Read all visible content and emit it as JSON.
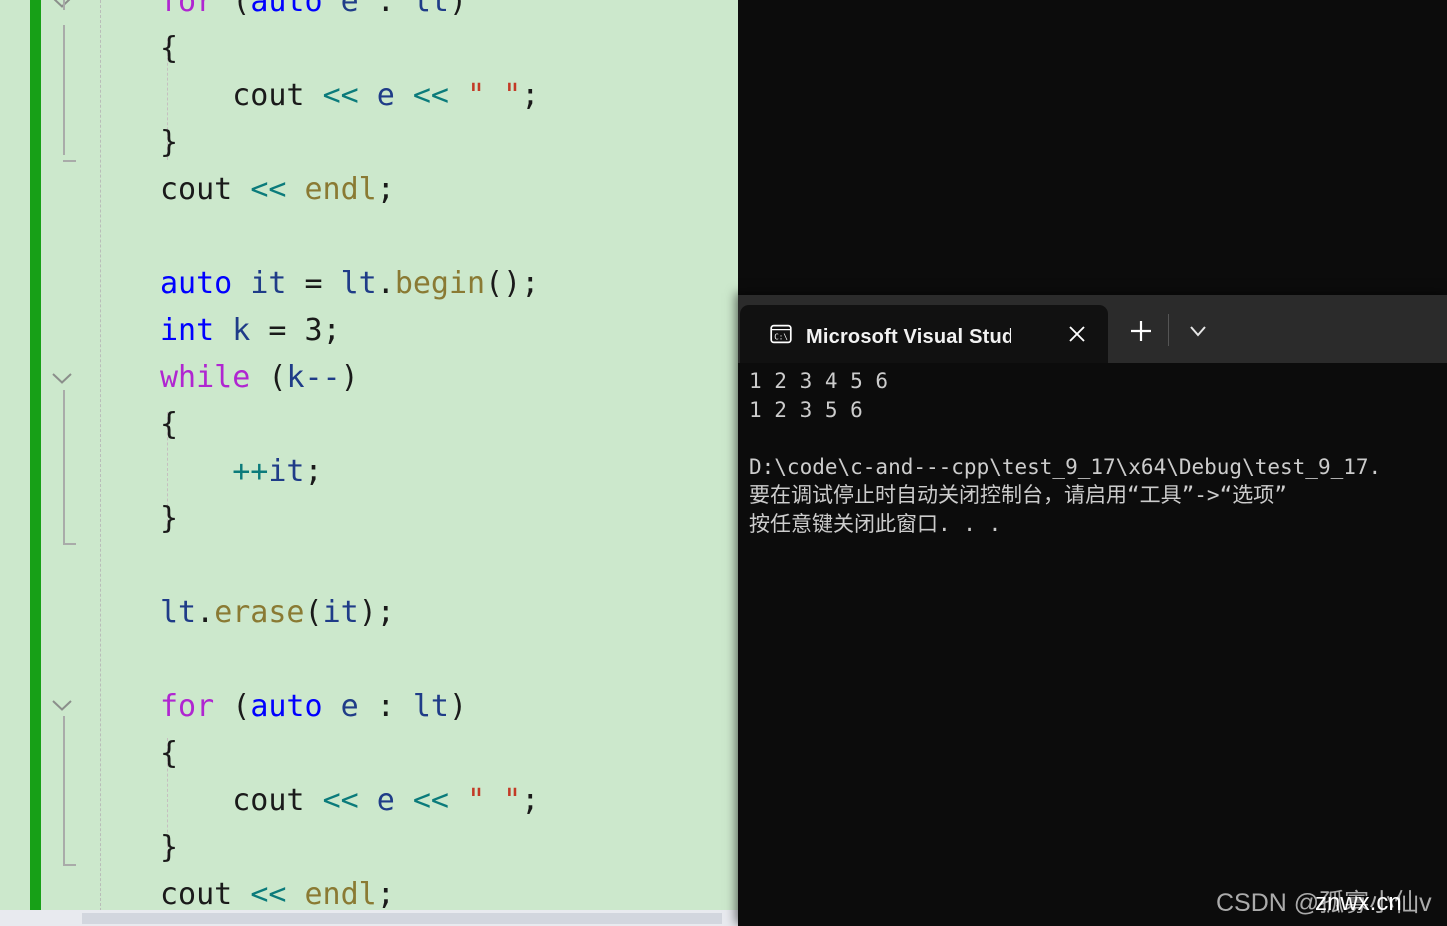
{
  "editor": {
    "name": "visual-studio-code-editor",
    "background_color": "#cce8cc",
    "change_bar_color": "#17a017",
    "lines": [
      {
        "indent": 0,
        "tokens": [
          {
            "t": "for",
            "c": "kwctl"
          },
          {
            "t": " ",
            "c": "plain"
          },
          {
            "t": "(",
            "c": "punct"
          },
          {
            "t": "auto",
            "c": "kw"
          },
          {
            "t": " ",
            "c": "plain"
          },
          {
            "t": "e",
            "c": "var"
          },
          {
            "t": " : ",
            "c": "punct"
          },
          {
            "t": "lt",
            "c": "var"
          },
          {
            "t": ")",
            "c": "punct"
          }
        ]
      },
      {
        "indent": 0,
        "tokens": [
          {
            "t": "{",
            "c": "punct"
          }
        ]
      },
      {
        "indent": 0,
        "tokens": [
          {
            "t": "    ",
            "c": "plain"
          },
          {
            "t": "cout",
            "c": "ident"
          },
          {
            "t": " ",
            "c": "plain"
          },
          {
            "t": "<<",
            "c": "op"
          },
          {
            "t": " ",
            "c": "plain"
          },
          {
            "t": "e",
            "c": "var"
          },
          {
            "t": " ",
            "c": "plain"
          },
          {
            "t": "<<",
            "c": "op"
          },
          {
            "t": " ",
            "c": "plain"
          },
          {
            "t": "\" \"",
            "c": "str"
          },
          {
            "t": ";",
            "c": "punct"
          }
        ]
      },
      {
        "indent": 0,
        "tokens": [
          {
            "t": "}",
            "c": "punct"
          }
        ]
      },
      {
        "indent": 0,
        "tokens": [
          {
            "t": "cout",
            "c": "ident"
          },
          {
            "t": " ",
            "c": "plain"
          },
          {
            "t": "<<",
            "c": "op"
          },
          {
            "t": " ",
            "c": "plain"
          },
          {
            "t": "endl",
            "c": "member"
          },
          {
            "t": ";",
            "c": "punct"
          }
        ]
      },
      {
        "indent": 0,
        "tokens": []
      },
      {
        "indent": 0,
        "tokens": [
          {
            "t": "auto",
            "c": "kw"
          },
          {
            "t": " ",
            "c": "plain"
          },
          {
            "t": "it",
            "c": "var"
          },
          {
            "t": " = ",
            "c": "punct"
          },
          {
            "t": "lt",
            "c": "var"
          },
          {
            "t": ".",
            "c": "punct"
          },
          {
            "t": "begin",
            "c": "member"
          },
          {
            "t": "();",
            "c": "punct"
          }
        ]
      },
      {
        "indent": 0,
        "tokens": [
          {
            "t": "int",
            "c": "kw"
          },
          {
            "t": " ",
            "c": "plain"
          },
          {
            "t": "k",
            "c": "var"
          },
          {
            "t": " = ",
            "c": "punct"
          },
          {
            "t": "3",
            "c": "plain"
          },
          {
            "t": ";",
            "c": "punct"
          }
        ]
      },
      {
        "indent": 0,
        "tokens": [
          {
            "t": "while",
            "c": "kwctl"
          },
          {
            "t": " ",
            "c": "plain"
          },
          {
            "t": "(",
            "c": "punct"
          },
          {
            "t": "k",
            "c": "var"
          },
          {
            "t": "--",
            "c": "var"
          },
          {
            "t": ")",
            "c": "punct"
          }
        ]
      },
      {
        "indent": 0,
        "tokens": [
          {
            "t": "{",
            "c": "punct"
          }
        ]
      },
      {
        "indent": 0,
        "tokens": [
          {
            "t": "    ",
            "c": "plain"
          },
          {
            "t": "++",
            "c": "op"
          },
          {
            "t": "it",
            "c": "var"
          },
          {
            "t": ";",
            "c": "punct"
          }
        ]
      },
      {
        "indent": 0,
        "tokens": [
          {
            "t": "}",
            "c": "punct"
          }
        ]
      },
      {
        "indent": 0,
        "tokens": []
      },
      {
        "indent": 0,
        "tokens": [
          {
            "t": "lt",
            "c": "var"
          },
          {
            "t": ".",
            "c": "punct"
          },
          {
            "t": "erase",
            "c": "member"
          },
          {
            "t": "(",
            "c": "punct"
          },
          {
            "t": "it",
            "c": "var"
          },
          {
            "t": ");",
            "c": "punct"
          }
        ]
      },
      {
        "indent": 0,
        "tokens": []
      },
      {
        "indent": 0,
        "tokens": [
          {
            "t": "for",
            "c": "kwctl"
          },
          {
            "t": " ",
            "c": "plain"
          },
          {
            "t": "(",
            "c": "punct"
          },
          {
            "t": "auto",
            "c": "kw"
          },
          {
            "t": " ",
            "c": "plain"
          },
          {
            "t": "e",
            "c": "var"
          },
          {
            "t": " : ",
            "c": "punct"
          },
          {
            "t": "lt",
            "c": "var"
          },
          {
            "t": ")",
            "c": "punct"
          }
        ]
      },
      {
        "indent": 0,
        "tokens": [
          {
            "t": "{",
            "c": "punct"
          }
        ]
      },
      {
        "indent": 0,
        "tokens": [
          {
            "t": "    ",
            "c": "plain"
          },
          {
            "t": "cout",
            "c": "ident"
          },
          {
            "t": " ",
            "c": "plain"
          },
          {
            "t": "<<",
            "c": "op"
          },
          {
            "t": " ",
            "c": "plain"
          },
          {
            "t": "e",
            "c": "var"
          },
          {
            "t": " ",
            "c": "plain"
          },
          {
            "t": "<<",
            "c": "op"
          },
          {
            "t": " ",
            "c": "plain"
          },
          {
            "t": "\" \"",
            "c": "str"
          },
          {
            "t": ";",
            "c": "punct"
          }
        ]
      },
      {
        "indent": 0,
        "tokens": [
          {
            "t": "}",
            "c": "punct"
          }
        ]
      },
      {
        "indent": 0,
        "tokens": [
          {
            "t": "cout",
            "c": "ident"
          },
          {
            "t": " ",
            "c": "plain"
          },
          {
            "t": "<<",
            "c": "op"
          },
          {
            "t": " ",
            "c": "plain"
          },
          {
            "t": "endl",
            "c": "member"
          },
          {
            "t": ";",
            "c": "punct"
          }
        ]
      }
    ]
  },
  "console": {
    "window_name": "microsoft-visual-studio-debug-console",
    "tab": {
      "icon": "cmd-console-icon",
      "title": "Microsoft Visual Studio 调试控",
      "close_label": "✕"
    },
    "new_tab_label": "+",
    "dropdown_label": "⌄",
    "background_color": "#0c0c0c",
    "text_color": "#cccccc",
    "output_lines": [
      "1 2 3 4 5 6",
      "1 2 3 5 6",
      "",
      "D:\\code\\c-and---cpp\\test_9_17\\x64\\Debug\\test_9_17.",
      "要在调试停止时自动关闭控制台，请启用“工具”->“选项”",
      "按任意键关闭此窗口. . ."
    ]
  },
  "watermark": {
    "text": "CSDN @孤寡小仙v",
    "overlay_text": "znwx.cn"
  }
}
